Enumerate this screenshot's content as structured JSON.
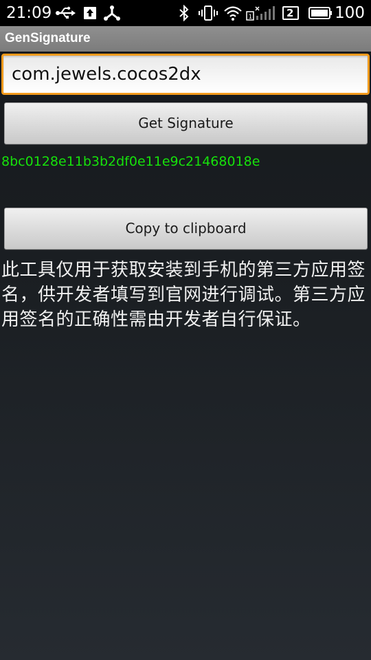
{
  "status_bar": {
    "time": "21:09",
    "battery_level": "100",
    "sim_slot": "2",
    "icons": [
      "usb-icon",
      "upload-icon",
      "share-node-icon",
      "bluetooth-icon",
      "vibrate-icon",
      "wifi-icon",
      "sim1-signal-icon",
      "sim2-signal-icon",
      "battery-icon"
    ]
  },
  "app": {
    "title": "GenSignature"
  },
  "form": {
    "package_value": "com.jewels.cocos2dx",
    "get_signature_label": "Get Signature",
    "signature_result": "8bc0128e11b3b2df0e11e9c21468018e",
    "copy_label": "Copy to clipboard"
  },
  "description": "此工具仅用于获取安装到手机的第三方应用签名，供开发者填写到官网进行调试。第三方应用签名的正确性需由开发者自行保证。",
  "colors": {
    "accent_focus": "#f39a1c",
    "signature_green": "#16e10b",
    "title_bar": "#858585"
  }
}
